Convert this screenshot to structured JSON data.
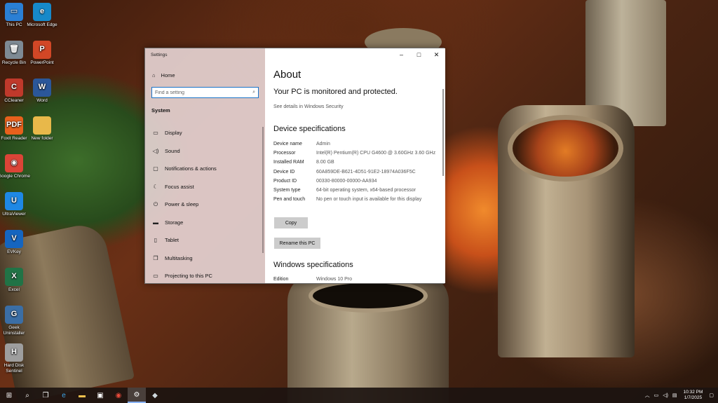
{
  "desktop": {
    "icons": [
      {
        "label": "This PC",
        "color": "#2a7fd4",
        "glyph": "▭",
        "icon": "this-pc-icon"
      },
      {
        "label": "Microsoft Edge",
        "color": "#1789c9",
        "glyph": "e",
        "icon": "edge-icon"
      },
      {
        "label": "Recycle Bin",
        "color": "#7e8a94",
        "glyph": "🗑",
        "icon": "recycle-bin-icon"
      },
      {
        "label": "PowerPoint",
        "color": "#d24726",
        "glyph": "P",
        "icon": "powerpoint-icon"
      },
      {
        "label": "CCleaner",
        "color": "#c0392b",
        "glyph": "C",
        "icon": "ccleaner-icon"
      },
      {
        "label": "Word",
        "color": "#2b579a",
        "glyph": "W",
        "icon": "word-icon"
      },
      {
        "label": "Foxit Reader",
        "color": "#e8601c",
        "glyph": "PDF",
        "icon": "foxit-reader-icon"
      },
      {
        "label": "New folder",
        "color": "#e8b84a",
        "glyph": "",
        "icon": "folder-icon"
      },
      {
        "label": "Google Chrome",
        "color": "#db4437",
        "glyph": "◉",
        "icon": "chrome-icon"
      },
      {
        "label": "UltraViewer",
        "color": "#1e88e5",
        "glyph": "U",
        "icon": "ultraviewer-icon"
      },
      {
        "label": "EVKey",
        "color": "#1565c0",
        "glyph": "V",
        "icon": "evkey-icon"
      },
      {
        "label": "Excel",
        "color": "#217346",
        "glyph": "X",
        "icon": "excel-icon"
      },
      {
        "label": "Geek Uninstaller",
        "color": "#3b6ea5",
        "glyph": "G",
        "icon": "geek-uninstaller-icon"
      },
      {
        "label": "Hard Disk Sentinel",
        "color": "#9e9e9e",
        "glyph": "H",
        "icon": "hard-disk-sentinel-icon"
      }
    ]
  },
  "window": {
    "title": "Settings",
    "controls": {
      "minimize": "–",
      "maximize": "□",
      "close": "✕"
    }
  },
  "sidebar": {
    "home_label": "Home",
    "search_placeholder": "Find a setting",
    "section_label": "System",
    "items": [
      {
        "label": "Display",
        "icon": "display-icon",
        "glyph": "▭"
      },
      {
        "label": "Sound",
        "icon": "sound-icon",
        "glyph": "◁)"
      },
      {
        "label": "Notifications & actions",
        "icon": "notifications-icon",
        "glyph": "▢"
      },
      {
        "label": "Focus assist",
        "icon": "focus-assist-icon",
        "glyph": "☾"
      },
      {
        "label": "Power & sleep",
        "icon": "power-icon",
        "glyph": "⏻"
      },
      {
        "label": "Storage",
        "icon": "storage-icon",
        "glyph": "▬"
      },
      {
        "label": "Tablet",
        "icon": "tablet-icon",
        "glyph": "▯"
      },
      {
        "label": "Multitasking",
        "icon": "multitasking-icon",
        "glyph": "❐"
      },
      {
        "label": "Projecting to this PC",
        "icon": "projecting-icon",
        "glyph": "▭"
      }
    ]
  },
  "about": {
    "heading": "About",
    "protection_status": "Your PC is monitored and protected.",
    "security_link": "See details in Windows Security",
    "device_heading": "Device specifications",
    "specs": [
      {
        "key": "Device name",
        "value": "Admin"
      },
      {
        "key": "Processor",
        "value": "Intel(R) Pentium(R) CPU G4600 @ 3.60GHz   3.60 GHz"
      },
      {
        "key": "Installed RAM",
        "value": "8.00 GB"
      },
      {
        "key": "Device ID",
        "value": "60A859DE-B621-4D51-91E2-18974A036F5C"
      },
      {
        "key": "Product ID",
        "value": "00330-80000-00000-AA934"
      },
      {
        "key": "System type",
        "value": "64-bit operating system, x64-based processor"
      },
      {
        "key": "Pen and touch",
        "value": "No pen or touch input is available for this display"
      }
    ],
    "copy_button": "Copy",
    "rename_button": "Rename this PC",
    "windows_heading": "Windows specifications",
    "edition": {
      "key": "Edition",
      "value": "Windows 10 Pro"
    }
  },
  "taskbar": {
    "time": "10:32 PM",
    "date": "1/7/2025"
  }
}
